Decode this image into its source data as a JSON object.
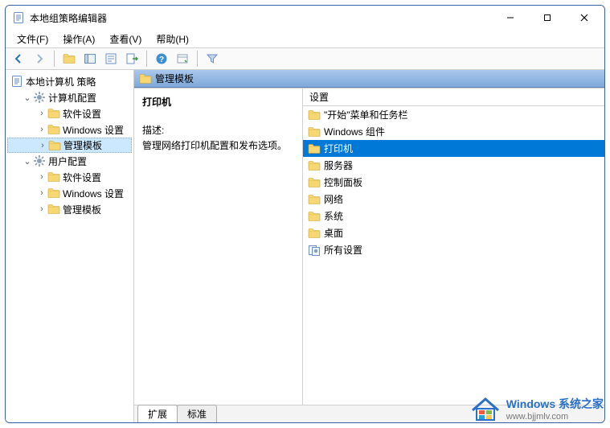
{
  "window": {
    "title": "本地组策略编辑器"
  },
  "menu": {
    "file": "文件(F)",
    "action": "操作(A)",
    "view": "查看(V)",
    "help": "帮助(H)"
  },
  "tree": {
    "root": "本地计算机 策略",
    "computer": "计算机配置",
    "comp_software": "软件设置",
    "comp_windows": "Windows 设置",
    "comp_admin": "管理模板",
    "user": "用户配置",
    "user_software": "软件设置",
    "user_windows": "Windows 设置",
    "user_admin": "管理模板"
  },
  "header": {
    "title": "管理模板"
  },
  "desc": {
    "heading": "打印机",
    "label": "描述:",
    "text": "管理网络打印机配置和发布选项。"
  },
  "list": {
    "column": "设置",
    "items": [
      "\"开始\"菜单和任务栏",
      "Windows 组件",
      "打印机",
      "服务器",
      "控制面板",
      "网络",
      "系统",
      "桌面",
      "所有设置"
    ],
    "selected_index": 2
  },
  "tabs": {
    "extended": "扩展",
    "standard": "标准"
  },
  "watermark": {
    "brand": "Windows 系统之家",
    "url": "www.bjjmlv.com"
  }
}
